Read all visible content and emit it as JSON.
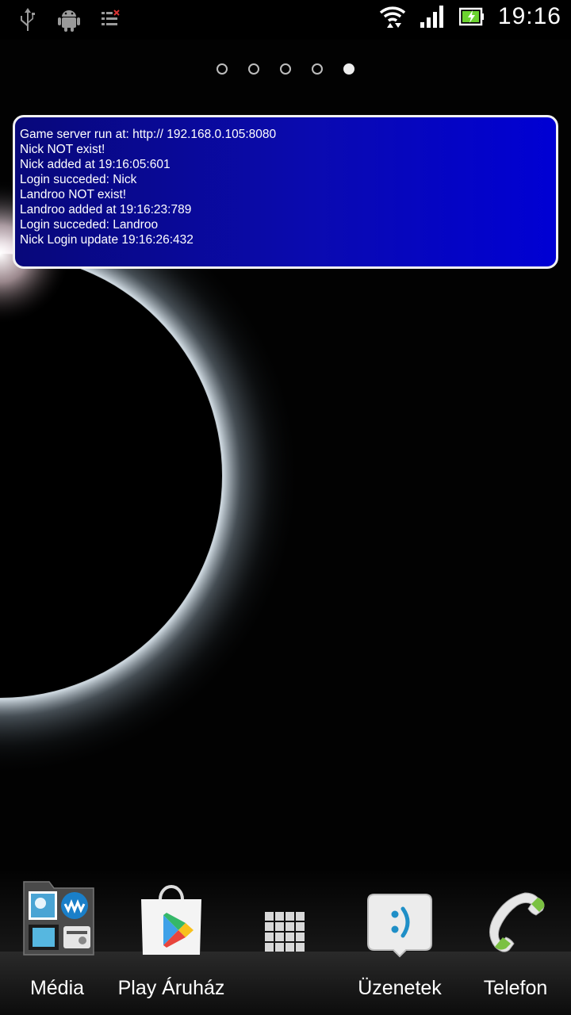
{
  "status_bar": {
    "icons_left": [
      "usb-icon",
      "android-debug-icon",
      "task-icon"
    ],
    "icons_right": [
      "wifi-icon",
      "signal-icon",
      "battery-icon"
    ],
    "time": "19:16"
  },
  "pager": {
    "page_count": 5,
    "active_index": 4
  },
  "widget": {
    "lines": [
      "Game server run at: http:// 192.168.0.105:8080",
      "Nick NOT exist!",
      "Nick added at 19:16:05:601",
      "Login succeded: Nick",
      "Landroo NOT exist!",
      "Landroo added at 19:16:23:789",
      "Login succeded: Landroo",
      "Nick Login update 19:16:26:432"
    ]
  },
  "dock": {
    "items": [
      {
        "label": "Média",
        "icon": "media-folder-icon"
      },
      {
        "label": "Play Áruház",
        "icon": "play-store-icon"
      },
      {
        "label": "",
        "icon": "app-drawer-icon"
      },
      {
        "label": "Üzenetek",
        "icon": "messages-icon"
      },
      {
        "label": "Telefon",
        "icon": "phone-icon"
      }
    ]
  }
}
